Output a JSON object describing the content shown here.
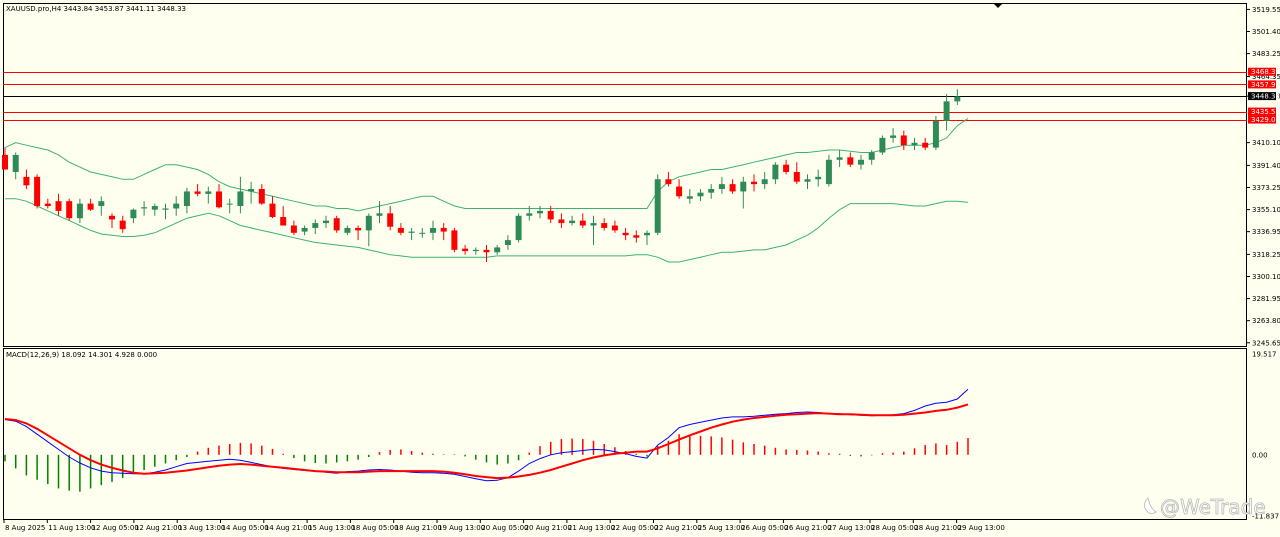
{
  "header": {
    "symbol": "XAUUSD.pro,H4",
    "ohlc": "3443.84 3453.87 3441.11 3448.33"
  },
  "macd_header": "MACD(12,26,9) 18.092 14.301 4.928 0.000",
  "watermark": "@WeTrade",
  "colors": {
    "background": "#fffff0",
    "bull_candle": "#2e8b57",
    "bear_candle": "#ff0000",
    "band_line": "#3cb371",
    "macd_line": "#0000ff",
    "signal_line": "#ff0000",
    "level_red": "#ff0000",
    "level_black": "#000000",
    "grid_border": "#000000"
  },
  "chart_data": [
    {
      "type": "candlestick",
      "title": "XAUUSD.pro,H4",
      "y_ticks": [
        3519.55,
        3501.4,
        3483.25,
        3464.35,
        3448.33,
        3410.1,
        3391.4,
        3373.25,
        3355.1,
        3336.95,
        3318.25,
        3300.1,
        3281.95,
        3263.8,
        3245.65
      ],
      "y_tick_labels": [
        "3519.55",
        "3501.40",
        "3483.25",
        "3464.35",
        "3448.33",
        "3410.10",
        "3391.40",
        "3373.25",
        "3355.10",
        "3336.95",
        "3318.25",
        "3300.10",
        "3281.95",
        "3263.80",
        "3245.65"
      ],
      "ylim": [
        3243,
        3524
      ],
      "x_tick_labels": [
        "8 Aug 2025",
        "11 Aug 13:00",
        "12 Aug 05:00",
        "12 Aug 21:00",
        "13 Aug 13:00",
        "14 Aug 05:00",
        "14 Aug 21:00",
        "15 Aug 13:00",
        "18 Aug 05:00",
        "18 Aug 21:00",
        "19 Aug 13:00",
        "20 Aug 05:00",
        "20 Aug 21:00",
        "21 Aug 13:00",
        "22 Aug 05:00",
        "22 Aug 21:00",
        "25 Aug 13:00",
        "26 Aug 05:00",
        "26 Aug 21:00",
        "27 Aug 13:00",
        "28 Aug 05:00",
        "28 Aug 21:00",
        "29 Aug 13:00"
      ],
      "levels": [
        {
          "price": 3468.35,
          "label": "3468.35",
          "color": "#ff0000"
        },
        {
          "price": 3457.95,
          "label": "3457.95",
          "color": "#ff0000"
        },
        {
          "price": 3448.33,
          "label": "3448.33",
          "color": "#000000"
        },
        {
          "price": 3435.59,
          "label": "3435.59",
          "color": "#ff0000"
        },
        {
          "price": 3429.06,
          "label": "3429.06",
          "color": "#ff0000"
        }
      ],
      "candles": [
        [
          3400,
          3406,
          3390,
          3388
        ],
        [
          3386,
          3402,
          3380,
          3400
        ],
        [
          3382,
          3388,
          3372,
          3375
        ],
        [
          3382,
          3384,
          3356,
          3358
        ],
        [
          3360,
          3364,
          3356,
          3358
        ],
        [
          3362,
          3368,
          3350,
          3354
        ],
        [
          3362,
          3364,
          3346,
          3348
        ],
        [
          3348,
          3364,
          3344,
          3360
        ],
        [
          3360,
          3364,
          3354,
          3355
        ],
        [
          3358,
          3366,
          3350,
          3362
        ],
        [
          3350,
          3352,
          3340,
          3347
        ],
        [
          3346,
          3350,
          3336,
          3339
        ],
        [
          3348,
          3356,
          3344,
          3355
        ],
        [
          3356,
          3362,
          3350,
          3357
        ],
        [
          3355,
          3360,
          3350,
          3358
        ],
        [
          3355,
          3360,
          3347,
          3356
        ],
        [
          3356,
          3366,
          3350,
          3360
        ],
        [
          3358,
          3373,
          3352,
          3370
        ],
        [
          3370,
          3376,
          3366,
          3368
        ],
        [
          3368,
          3374,
          3360,
          3370
        ],
        [
          3370,
          3376,
          3356,
          3357
        ],
        [
          3360,
          3364,
          3352,
          3360
        ],
        [
          3358,
          3382,
          3352,
          3370
        ],
        [
          3370,
          3378,
          3360,
          3372
        ],
        [
          3372,
          3376,
          3359,
          3360
        ],
        [
          3360,
          3366,
          3348,
          3349
        ],
        [
          3349,
          3358,
          3345,
          3342
        ],
        [
          3342,
          3346,
          3334,
          3336
        ],
        [
          3337,
          3342,
          3334,
          3340
        ],
        [
          3340,
          3347,
          3335,
          3344
        ],
        [
          3344,
          3350,
          3340,
          3346
        ],
        [
          3348,
          3350,
          3336,
          3338
        ],
        [
          3336,
          3342,
          3334,
          3340
        ],
        [
          3340,
          3342,
          3330,
          3338
        ],
        [
          3338,
          3352,
          3325,
          3350
        ],
        [
          3350,
          3362,
          3344,
          3352
        ],
        [
          3352,
          3358,
          3338,
          3341
        ],
        [
          3340,
          3344,
          3334,
          3336
        ],
        [
          3336,
          3340,
          3330,
          3337
        ],
        [
          3336,
          3340,
          3332,
          3336
        ],
        [
          3336,
          3346,
          3330,
          3340
        ],
        [
          3340,
          3344,
          3330,
          3337
        ],
        [
          3338,
          3340,
          3320,
          3322
        ],
        [
          3323,
          3326,
          3318,
          3321
        ],
        [
          3321,
          3324,
          3318,
          3322
        ],
        [
          3322,
          3326,
          3312,
          3320
        ],
        [
          3320,
          3326,
          3318,
          3324
        ],
        [
          3326,
          3334,
          3322,
          3330
        ],
        [
          3330,
          3352,
          3328,
          3350
        ],
        [
          3350,
          3358,
          3346,
          3352
        ],
        [
          3352,
          3358,
          3348,
          3354
        ],
        [
          3354,
          3358,
          3344,
          3347
        ],
        [
          3347,
          3352,
          3340,
          3344
        ],
        [
          3344,
          3350,
          3342,
          3346
        ],
        [
          3346,
          3352,
          3340,
          3342
        ],
        [
          3342,
          3350,
          3326,
          3344
        ],
        [
          3344,
          3348,
          3338,
          3340
        ],
        [
          3342,
          3346,
          3336,
          3338
        ],
        [
          3336,
          3340,
          3330,
          3334
        ],
        [
          3334,
          3338,
          3328,
          3332
        ],
        [
          3334,
          3338,
          3326,
          3336
        ],
        [
          3336,
          3384,
          3334,
          3380
        ],
        [
          3380,
          3386,
          3374,
          3376
        ],
        [
          3374,
          3380,
          3364,
          3366
        ],
        [
          3364,
          3372,
          3360,
          3366
        ],
        [
          3366,
          3372,
          3362,
          3369
        ],
        [
          3369,
          3376,
          3364,
          3372
        ],
        [
          3372,
          3382,
          3368,
          3376
        ],
        [
          3376,
          3380,
          3368,
          3370
        ],
        [
          3370,
          3382,
          3356,
          3378
        ],
        [
          3378,
          3384,
          3370,
          3376
        ],
        [
          3376,
          3386,
          3372,
          3380
        ],
        [
          3380,
          3394,
          3376,
          3392
        ],
        [
          3392,
          3396,
          3384,
          3386
        ],
        [
          3386,
          3394,
          3376,
          3378
        ],
        [
          3378,
          3384,
          3372,
          3380
        ],
        [
          3380,
          3388,
          3374,
          3382
        ],
        [
          3376,
          3400,
          3374,
          3396
        ],
        [
          3396,
          3404,
          3390,
          3398
        ],
        [
          3398,
          3402,
          3390,
          3392
        ],
        [
          3392,
          3400,
          3388,
          3396
        ],
        [
          3396,
          3404,
          3392,
          3402
        ],
        [
          3402,
          3416,
          3400,
          3414
        ],
        [
          3414,
          3422,
          3410,
          3416
        ],
        [
          3416,
          3420,
          3404,
          3408
        ],
        [
          3408,
          3414,
          3404,
          3410
        ],
        [
          3410,
          3414,
          3404,
          3406
        ],
        [
          3406,
          3432,
          3404,
          3428
        ],
        [
          3428,
          3450,
          3420,
          3444
        ],
        [
          3444,
          3454,
          3441,
          3448
        ]
      ],
      "bollinger": {
        "upper": [
          3406,
          3410,
          3408,
          3406,
          3404,
          3400,
          3394,
          3390,
          3386,
          3384,
          3382,
          3380,
          3380,
          3384,
          3388,
          3392,
          3392,
          3390,
          3388,
          3384,
          3378,
          3374,
          3372,
          3370,
          3368,
          3366,
          3364,
          3362,
          3360,
          3358,
          3358,
          3356,
          3356,
          3354,
          3356,
          3358,
          3360,
          3362,
          3364,
          3366,
          3366,
          3362,
          3358,
          3356,
          3356,
          3356,
          3356,
          3356,
          3356,
          3356,
          3356,
          3356,
          3356,
          3356,
          3356,
          3356,
          3356,
          3356,
          3356,
          3356,
          3356,
          3370,
          3378,
          3382,
          3384,
          3386,
          3388,
          3388,
          3390,
          3392,
          3394,
          3396,
          3398,
          3400,
          3402,
          3402,
          3403,
          3404,
          3404,
          3403,
          3402,
          3402,
          3404,
          3406,
          3408,
          3408,
          3408,
          3410,
          3414,
          3424,
          3430
        ],
        "lower": [
          3364,
          3364,
          3362,
          3358,
          3354,
          3350,
          3346,
          3342,
          3338,
          3335,
          3334,
          3333,
          3333,
          3334,
          3336,
          3340,
          3344,
          3348,
          3350,
          3352,
          3350,
          3346,
          3342,
          3340,
          3338,
          3336,
          3334,
          3332,
          3330,
          3328,
          3327,
          3326,
          3325,
          3324,
          3322,
          3320,
          3318,
          3317,
          3316,
          3316,
          3316,
          3316,
          3316,
          3316,
          3316,
          3316,
          3317,
          3317,
          3317,
          3317,
          3317,
          3317,
          3317,
          3317,
          3317,
          3317,
          3317,
          3317,
          3317,
          3318,
          3318,
          3316,
          3312,
          3312,
          3314,
          3316,
          3318,
          3320,
          3320,
          3321,
          3322,
          3322,
          3324,
          3326,
          3330,
          3334,
          3340,
          3348,
          3355,
          3360,
          3360,
          3360,
          3360,
          3360,
          3359,
          3358,
          3358,
          3360,
          3362,
          3362,
          3361
        ],
        "middle": [
          3385,
          3387,
          3385,
          3382,
          3379,
          3375,
          3370,
          3366,
          3362,
          3359,
          3358,
          3356,
          3356,
          3359,
          3362,
          3366,
          3368,
          3369,
          3369,
          3368,
          3364,
          3360,
          3357,
          3355,
          3353,
          3351,
          3349,
          3347,
          3345,
          3343,
          3342,
          3341,
          3340,
          3339,
          3339,
          3339,
          3339,
          3339,
          3340,
          3341,
          3341,
          3339,
          3337,
          3336,
          3336,
          3336,
          3336,
          3336,
          3336,
          3336,
          3336,
          3336,
          3336,
          3336,
          3336,
          3336,
          3336,
          3336,
          3336,
          3337,
          3337,
          3343,
          3345,
          3347,
          3349,
          3351,
          3353,
          3354,
          3355,
          3356,
          3358,
          3359,
          3361,
          3363,
          3366,
          3368,
          3371,
          3376,
          3380,
          3382,
          3381,
          3381,
          3382,
          3383,
          3384,
          3383,
          3383,
          3385,
          3388,
          3393,
          3396
        ]
      },
      "candle_colors": {
        "bull": "#2e8b57",
        "bear": "#ff0000"
      }
    },
    {
      "type": "bar_line",
      "title": "MACD(12,26,9) 18.092 14.301 4.928 0.000",
      "y_tick_labels": [
        "19.517",
        "0.00",
        "-11.837"
      ],
      "ylim": [
        -11.837,
        19.517
      ],
      "histogram": [
        -1.2,
        -2.5,
        -3.8,
        -4.6,
        -5.4,
        -6.2,
        -6.6,
        -6.8,
        -6.2,
        -5.6,
        -5.0,
        -4.3,
        -3.5,
        -2.8,
        -2.2,
        -1.6,
        -1.0,
        -0.4,
        0.6,
        1.3,
        1.7,
        2.0,
        2.2,
        2.1,
        1.7,
        1.1,
        0.2,
        -0.6,
        -1.2,
        -1.5,
        -1.6,
        -1.4,
        -1.2,
        -0.9,
        -0.4,
        0.5,
        0.9,
        1.0,
        0.7,
        0.4,
        0.2,
        0.1,
        0.1,
        -0.3,
        -0.9,
        -1.4,
        -1.8,
        -1.6,
        -1.0,
        0.4,
        1.6,
        2.4,
        2.9,
        3.0,
        2.9,
        2.6,
        2.0,
        1.4,
        0.7,
        0.2,
        -0.3,
        1.6,
        2.6,
        3.8,
        3.6,
        3.5,
        3.4,
        3.2,
        2.8,
        2.3,
        2.0,
        1.7,
        1.3,
        1.0,
        0.9,
        0.8,
        0.6,
        0.3,
        0.2,
        -0.2,
        -0.3,
        -0.1,
        0.3,
        0.4,
        0.6,
        1.2,
        1.8,
        2.1,
        1.8,
        2.4,
        3.1
      ],
      "macd_line": [
        6.5,
        6.2,
        5.2,
        3.8,
        2.4,
        1.0,
        -0.4,
        -1.5,
        -2.4,
        -3.0,
        -3.3,
        -3.4,
        -3.5,
        -3.5,
        -3.2,
        -2.8,
        -2.2,
        -1.6,
        -1.4,
        -1.2,
        -1.0,
        -0.8,
        -1.0,
        -1.4,
        -1.8,
        -2.2,
        -2.5,
        -2.7,
        -2.9,
        -3.0,
        -3.2,
        -3.4,
        -3.1,
        -3.0,
        -2.8,
        -2.7,
        -2.8,
        -3.0,
        -3.2,
        -3.3,
        -3.3,
        -3.4,
        -3.6,
        -4.0,
        -4.4,
        -4.8,
        -4.7,
        -4.2,
        -3.0,
        -1.6,
        -0.7,
        0.0,
        0.4,
        0.6,
        0.8,
        1.0,
        0.9,
        0.6,
        0.2,
        -0.3,
        -0.6,
        1.8,
        3.2,
        5.0,
        5.6,
        6.0,
        6.4,
        6.8,
        7.0,
        7.0,
        7.1,
        7.3,
        7.5,
        7.6,
        7.8,
        7.9,
        7.8,
        7.6,
        7.6,
        7.4,
        7.3,
        7.2,
        7.3,
        7.4,
        7.6,
        8.2,
        9.0,
        9.5,
        9.7,
        10.3,
        12.1
      ],
      "signal_line": [
        6.6,
        6.4,
        5.8,
        4.8,
        3.6,
        2.4,
        1.2,
        0.0,
        -1.0,
        -1.8,
        -2.4,
        -2.9,
        -3.3,
        -3.5,
        -3.4,
        -3.3,
        -3.1,
        -2.9,
        -2.6,
        -2.3,
        -2.0,
        -1.8,
        -1.7,
        -1.8,
        -2.0,
        -2.2,
        -2.4,
        -2.6,
        -2.8,
        -3.0,
        -3.1,
        -3.2,
        -3.2,
        -3.2,
        -3.1,
        -3.0,
        -3.0,
        -3.0,
        -3.0,
        -3.0,
        -3.0,
        -3.1,
        -3.3,
        -3.6,
        -3.9,
        -4.1,
        -4.3,
        -4.2,
        -4.0,
        -3.7,
        -3.3,
        -2.8,
        -2.2,
        -1.6,
        -1.0,
        -0.5,
        -0.1,
        0.2,
        0.4,
        0.6,
        0.6,
        1.2,
        2.0,
        2.8,
        3.6,
        4.3,
        5.0,
        5.6,
        6.1,
        6.5,
        6.8,
        7.0,
        7.2,
        7.4,
        7.5,
        7.6,
        7.7,
        7.6,
        7.5,
        7.5,
        7.4,
        7.3,
        7.3,
        7.3,
        7.4,
        7.6,
        7.8,
        8.1,
        8.3,
        8.7,
        9.3
      ]
    }
  ]
}
